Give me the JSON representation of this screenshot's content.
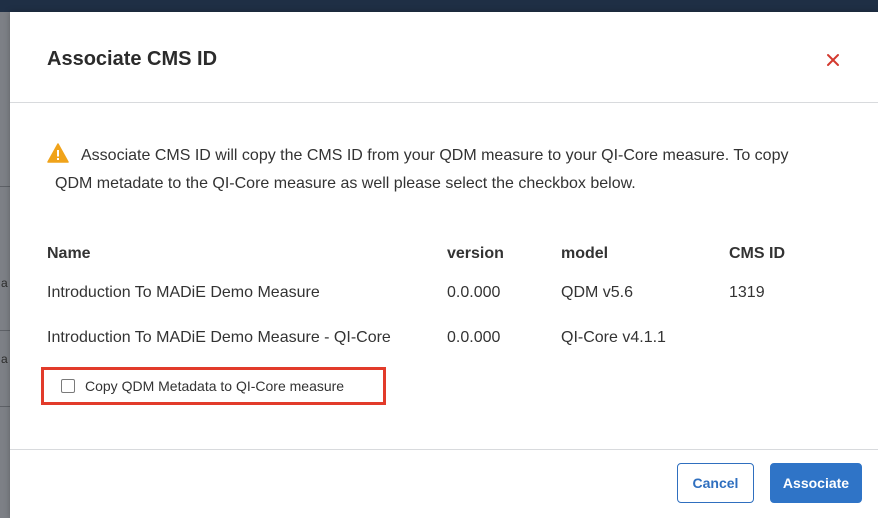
{
  "modal": {
    "title": "Associate CMS ID",
    "close_icon": "close-icon"
  },
  "warning": {
    "icon": "warning-icon",
    "line1": "Associate CMS ID will copy the CMS ID from your QDM measure to your QI-Core measure. To copy",
    "line2": "QDM metadate to the QI-Core measure as well please select the checkbox below."
  },
  "table": {
    "headers": [
      "Name",
      "version",
      "model",
      "CMS ID"
    ],
    "rows": [
      [
        "Introduction To MADiE Demo Measure",
        "0.0.000",
        "QDM v5.6",
        "1319"
      ],
      [
        "Introduction To MADiE Demo Measure - QI-Core",
        "0.0.000",
        "QI-Core v4.1.1",
        ""
      ]
    ]
  },
  "checkbox": {
    "label": "Copy QDM Metadata to QI-Core measure",
    "checked": false
  },
  "footer": {
    "cancel_label": "Cancel",
    "associate_label": "Associate"
  },
  "background": {
    "letters": [
      "a",
      "a"
    ]
  },
  "colors": {
    "primary": "#2f74c7",
    "close": "#d33a2f",
    "highlight_border": "#e23b2a",
    "warning": "#f0a31a"
  }
}
